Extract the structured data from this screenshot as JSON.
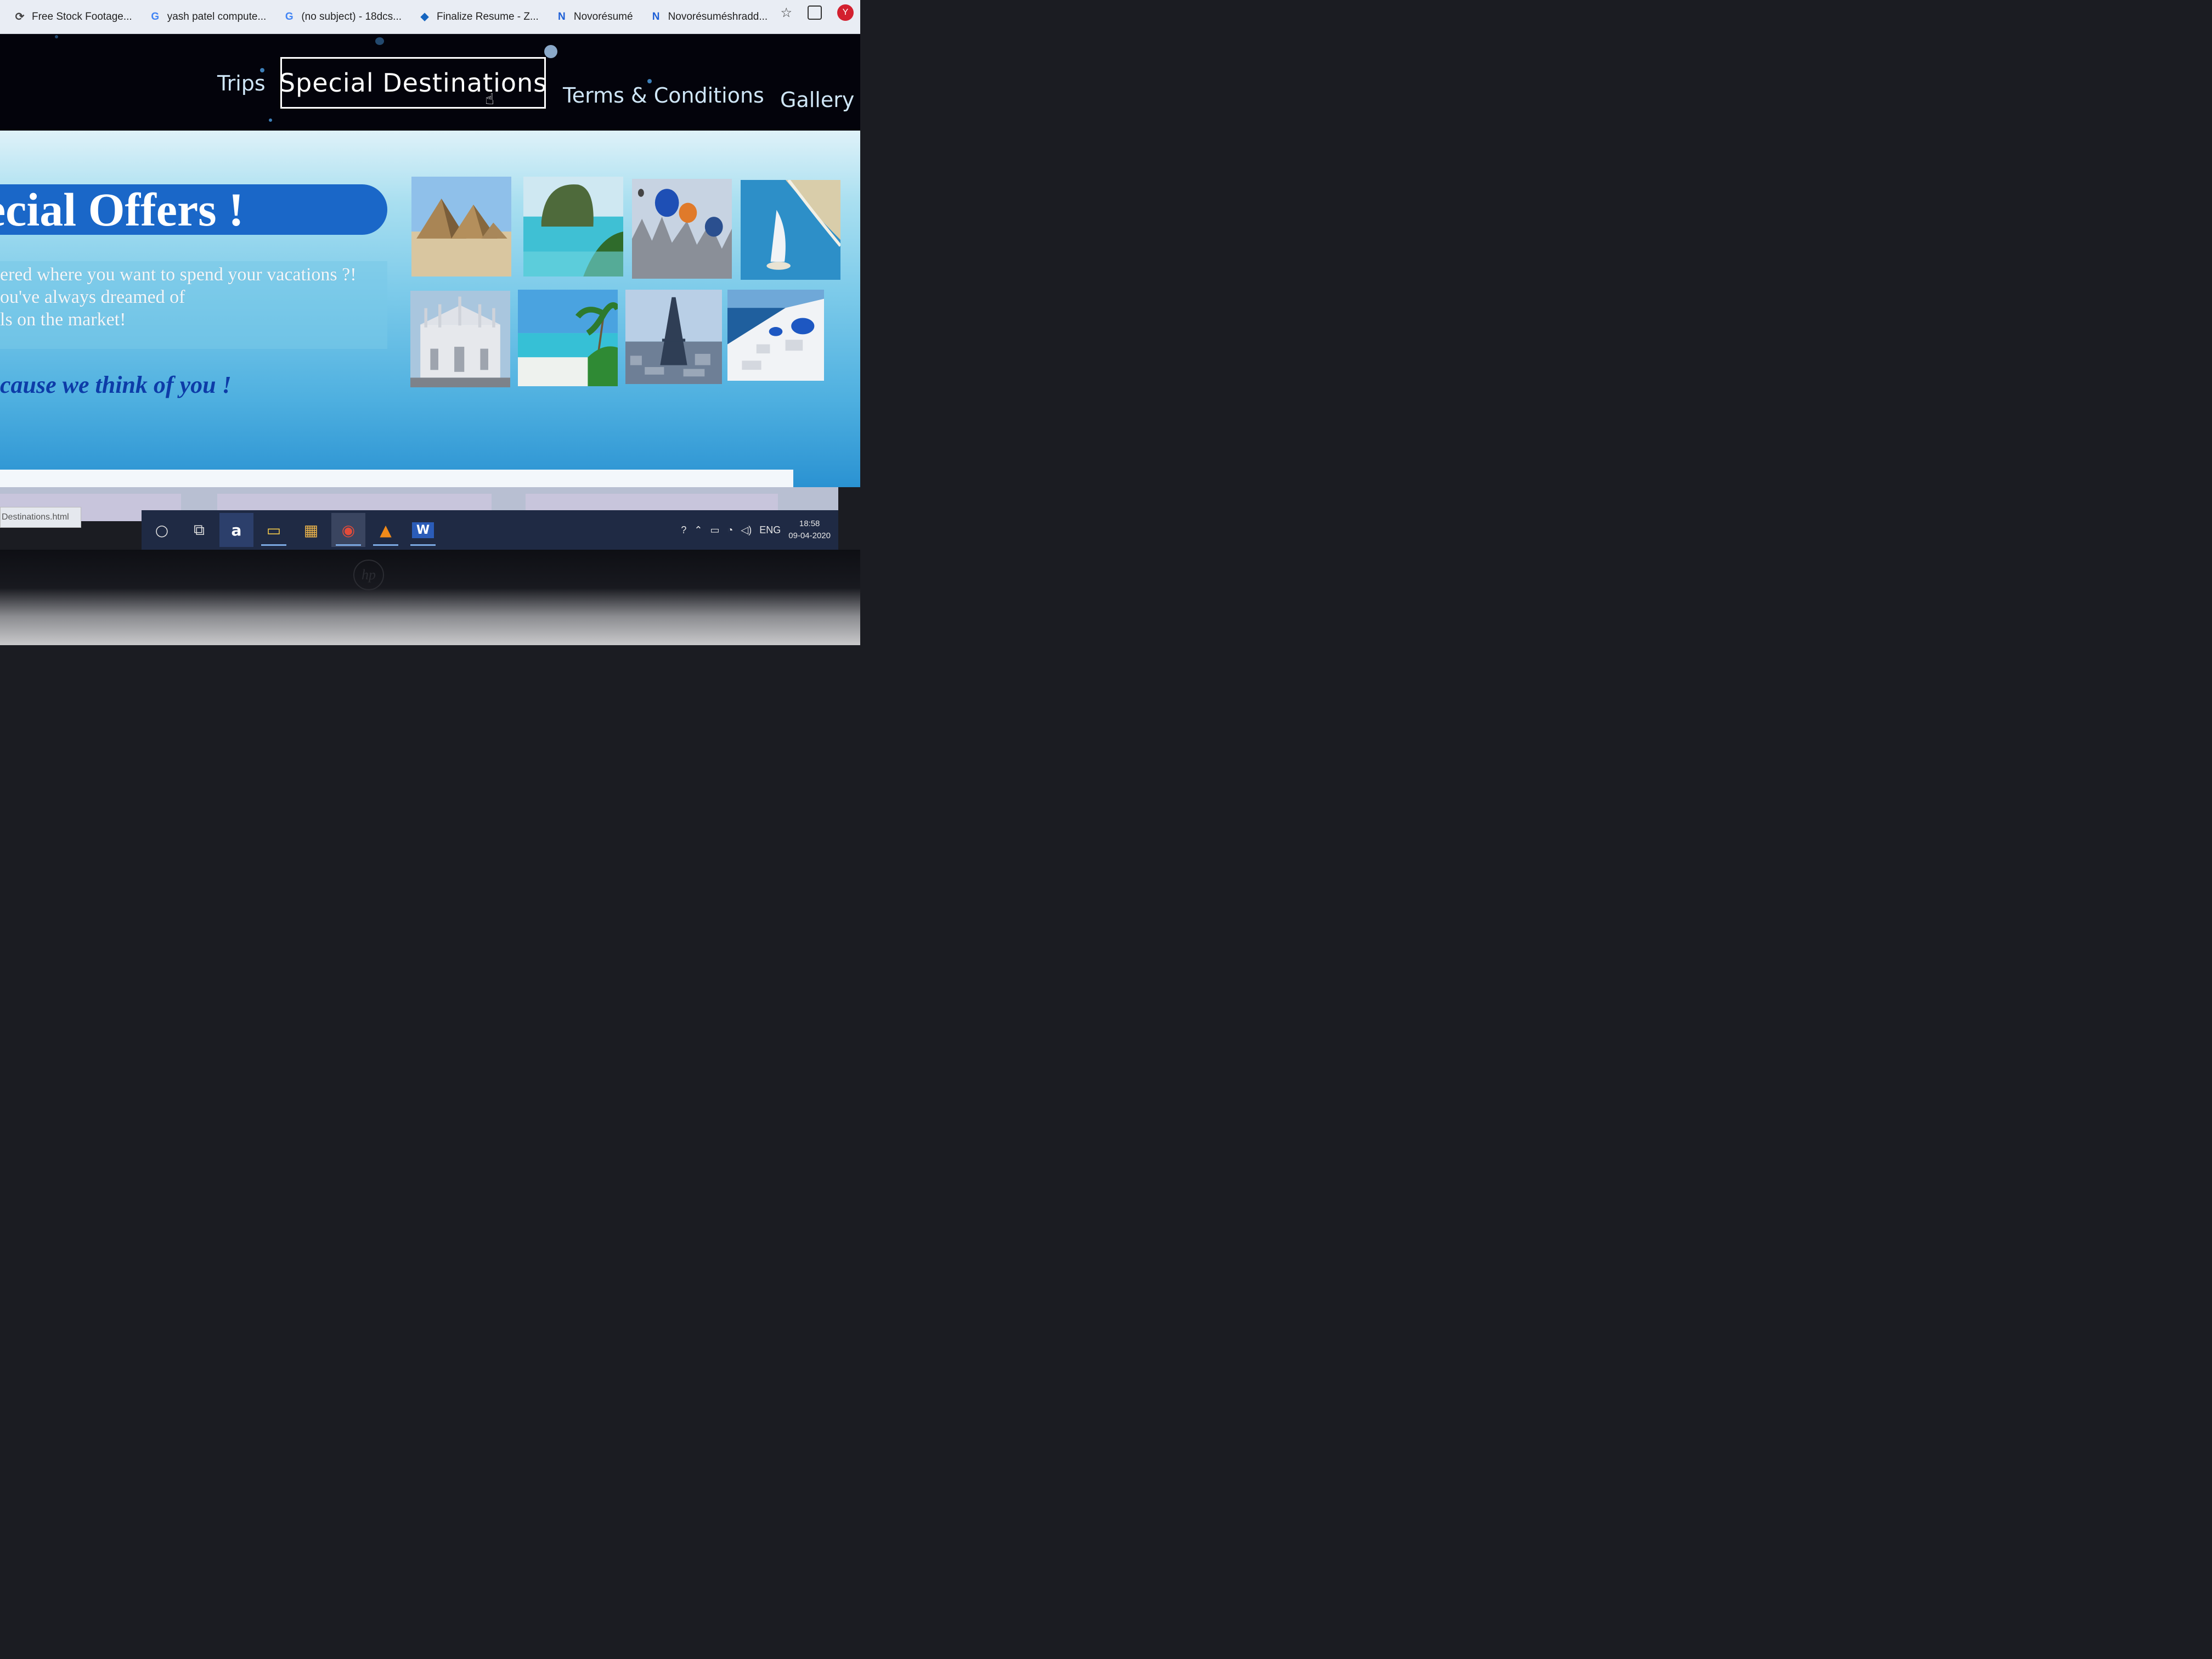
{
  "browser": {
    "bookmarks": [
      {
        "label": "Free Stock Footage...",
        "icon": "reload-icon"
      },
      {
        "label": "yash patel compute...",
        "icon": "google-icon"
      },
      {
        "label": "(no subject) - 18dcs...",
        "icon": "google-icon"
      },
      {
        "label": "Finalize Resume - Z...",
        "icon": "zety-icon"
      },
      {
        "label": "Novorésumé",
        "icon": "novoresume-icon"
      },
      {
        "label": "Novorésuméshradd...",
        "icon": "novoresume-icon"
      }
    ],
    "profile_initial": "Y"
  },
  "nav": {
    "items": [
      {
        "label": "Trips",
        "active": false
      },
      {
        "label": "Special Destinations",
        "active": true
      },
      {
        "label": "Terms & Conditions",
        "active": false
      },
      {
        "label": "Gallery",
        "active": false
      }
    ]
  },
  "main": {
    "banner_title": "ecial Offers !",
    "description_lines": [
      "ered where you want to spend your vacations ?!",
      "ou've always dreamed of",
      "ls on the market!"
    ],
    "tagline": "cause we think of you !",
    "gallery": [
      {
        "name": "pyramids-image"
      },
      {
        "name": "tropical-bay-image"
      },
      {
        "name": "hot-air-balloons-image"
      },
      {
        "name": "burj-al-arab-image"
      },
      {
        "name": "milan-cathedral-image"
      },
      {
        "name": "palm-beach-image"
      },
      {
        "name": "eiffel-tower-image"
      },
      {
        "name": "santorini-image"
      }
    ]
  },
  "status_bar": {
    "text": "Destinations.html"
  },
  "taskbar": {
    "apps": [
      {
        "name": "cortana-search",
        "glyph": "○"
      },
      {
        "name": "task-view",
        "glyph": "⧉"
      },
      {
        "name": "amazon",
        "glyph": "a"
      },
      {
        "name": "file-explorer",
        "glyph": "▭"
      },
      {
        "name": "microsoft-store",
        "glyph": "▦"
      },
      {
        "name": "chrome",
        "glyph": "◉"
      },
      {
        "name": "vlc",
        "glyph": "▲"
      },
      {
        "name": "word",
        "glyph": "W"
      }
    ],
    "language": "ENG",
    "time": "18:58",
    "date": "09-04-2020"
  },
  "colors": {
    "nav_bg": "#03030b",
    "banner_bg": "#1a67c8",
    "tagline": "#0d3ca8"
  }
}
